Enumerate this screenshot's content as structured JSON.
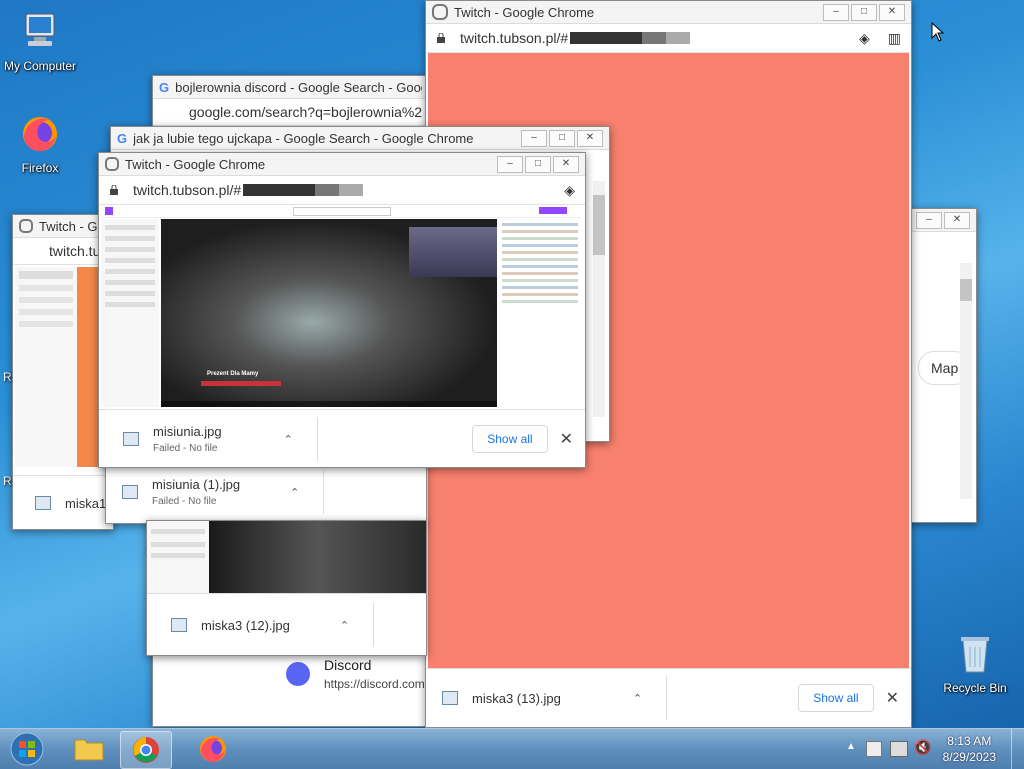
{
  "desktop": {
    "icons": [
      {
        "label": "My Computer"
      },
      {
        "label": "Firefox"
      },
      {
        "label": "Recycle Bin"
      }
    ]
  },
  "windows": {
    "twitch_main": {
      "title": "Twitch - Google Chrome",
      "url": "twitch.tubson.pl/#",
      "page_color": "#f8806f",
      "download": {
        "file": "miska3 (13).jpg",
        "show_all": "Show all"
      }
    },
    "google_search": {
      "title": "bojlerownia discord - Google Search - Google C",
      "url": "google.com/search?q=bojlerownia%2",
      "result_title": "Discord",
      "result_url": "https://discord.com",
      "map_button": "Map"
    },
    "search_ujckapa": {
      "title": "jak ja lubie tego ujckapa - Google Search - Google Chrome"
    },
    "twitch_front": {
      "title": "Twitch - Google Chrome",
      "url": "twitch.tubson.pl/#",
      "download": {
        "file": "misiunia.jpg",
        "status": "Failed - No file",
        "show_all": "Show all"
      },
      "stream_overlay_caption": "Prezent Dla Mamy"
    },
    "twitch_left": {
      "title": "Twitch - Goo",
      "url": "twitch.tu",
      "download": {
        "file": "miska1"
      }
    },
    "download_bar_2": {
      "file": "misiunia (1).jpg",
      "status": "Failed - No file"
    },
    "download_bar_3": {
      "file": "miska3 (12).jpg"
    },
    "partial_letter_r1": "R",
    "partial_letter_r2": "R"
  },
  "taskbar": {
    "time": "8:13 AM",
    "date": "8/29/2023"
  },
  "colors": {
    "accent": "#1a73e8",
    "twitch_purple": "#9147ff",
    "page_salmon": "#f8806f"
  }
}
